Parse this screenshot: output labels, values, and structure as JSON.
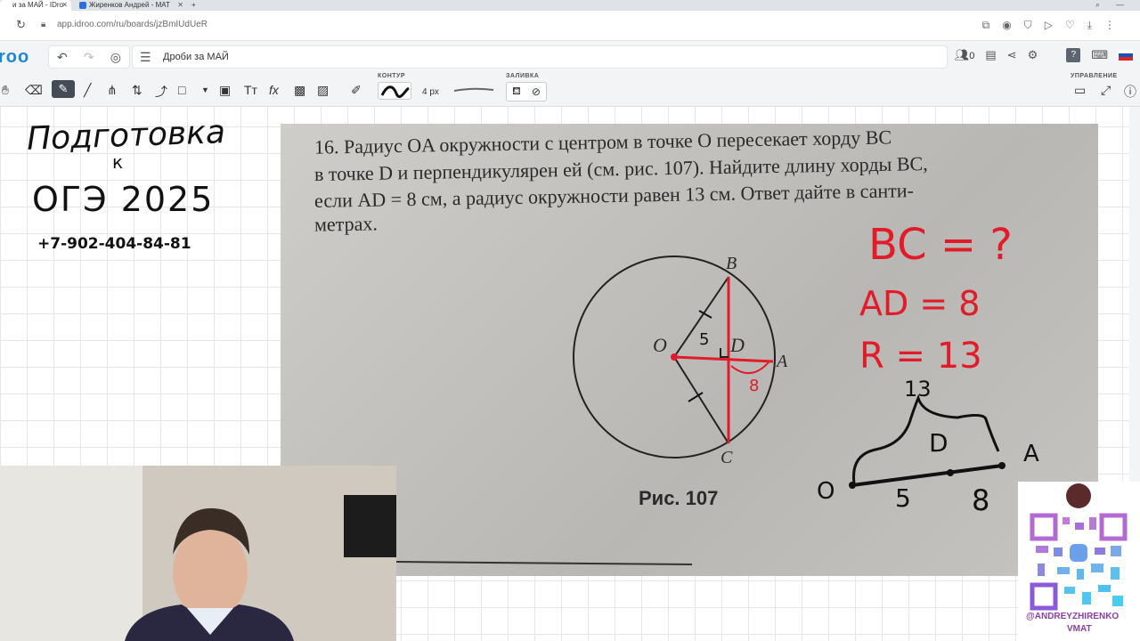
{
  "browser": {
    "tabs": [
      {
        "label": "и за МАЙ - IDro"
      },
      {
        "label": "Жиренков Андрей - МАТ"
      }
    ],
    "url": "app.idroo.com/ru/boards/jzBmIUdUeR"
  },
  "app": {
    "logo": "roo",
    "board_title": "Дроби за МАЙ",
    "users_count": "0",
    "help_label": "?",
    "toolbar": {
      "contour_label": "КОНТУР",
      "fill_label": "ЗАЛИВКА",
      "manage_label": "УПРАВЛЕНИЕ",
      "stroke_width": "4 px"
    }
  },
  "whiteboard": {
    "heading_line1": "Подготовка",
    "heading_line2": "к",
    "heading_line3": "ОГЭ 2025",
    "phone": "+7-902-404-84-81"
  },
  "problem": {
    "line1": "16. Радиус OA окружности с центром в точке O пересекает хорду BC",
    "line2": "в точке D и перпендикулярен ей (см. рис. 107). Найдите длину хорды BC,",
    "line3": "если AD = 8 см, а радиус окружности равен 13 см. Ответ дайте в санти-",
    "line4": "метрах.",
    "caption": "Рис. 107",
    "points": {
      "B": "B",
      "O": "O",
      "D": "D",
      "A": "A",
      "C": "C"
    },
    "annotation_5": "5",
    "annotation_8": "8"
  },
  "notes": {
    "bc": "BC = ?",
    "ad": "AD = 8",
    "r": "R = 13",
    "sketch_13": "13",
    "sketch_D": "D",
    "sketch_A": "A",
    "sketch_O": "O",
    "sketch_5": "5",
    "sketch_8": "8"
  },
  "qr": {
    "handle_line1": "@ANDREYZHIRENKO",
    "handle_line2": "VMAT"
  },
  "colors": {
    "accent": "#1e88d6",
    "ink_red": "#e11b2a",
    "qr_purple": "#8a3fa5"
  }
}
